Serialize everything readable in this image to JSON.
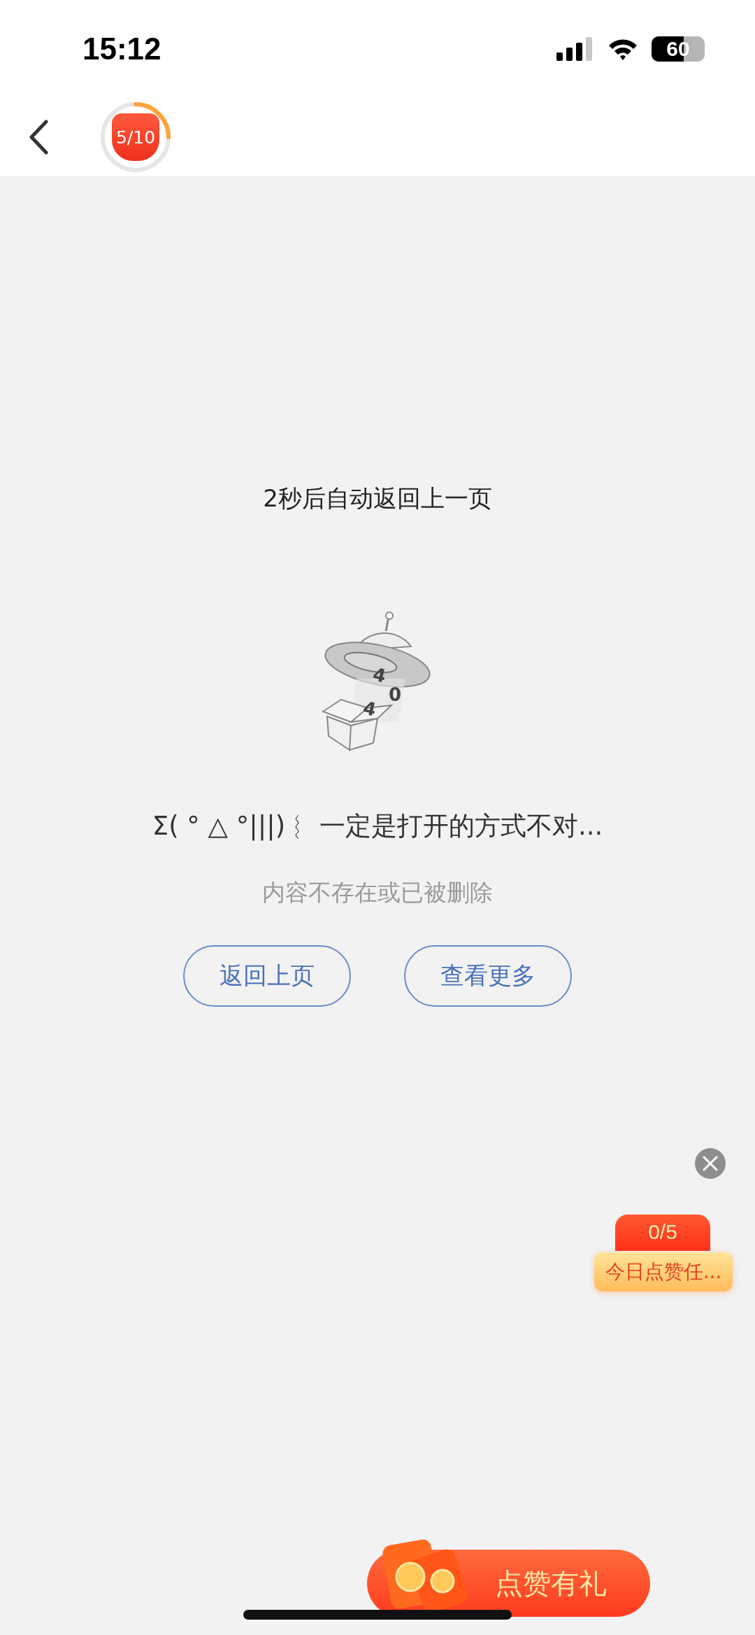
{
  "status_bar": {
    "time": "15:12",
    "battery": "60"
  },
  "header": {
    "progress_badge": {
      "label": "5/10",
      "level": 0.25
    }
  },
  "countdown": "2秒后自动返回上一页",
  "illustration": {
    "digits": [
      "4",
      "0",
      "4"
    ]
  },
  "message": "Σ( ° △ °|||)︴ 一定是打开的方式不对...",
  "subtitle": "内容不存在或已被删除",
  "buttons": [
    "返回上页",
    "查看更多"
  ],
  "task_widget": {
    "count": "0/5",
    "label": "今日点赞任..."
  },
  "promo_banner": {
    "label": "点赞有礼"
  }
}
